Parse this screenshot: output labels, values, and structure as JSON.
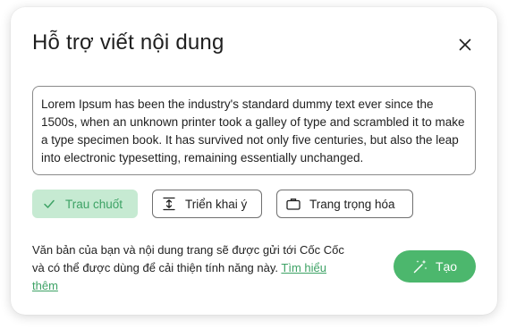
{
  "dialog": {
    "title": "Hỗ trợ viết nội dung",
    "close_icon": "close-icon"
  },
  "editor": {
    "text": "Lorem Ipsum has been the industry's standard dummy text ever since the 1500s, when an unknown printer took a galley of type and scrambled it to make a type specimen book. It has survived not only five centuries, but also the leap into electronic typesetting, remaining essentially unchanged."
  },
  "chips": [
    {
      "label": "Trau chuốt",
      "icon": "check-icon",
      "active": true
    },
    {
      "label": "Triển khai ý",
      "icon": "expand-vertical-icon",
      "active": false
    },
    {
      "label": "Trang trọng hóa",
      "icon": "briefcase-icon",
      "active": false
    }
  ],
  "footer": {
    "notice": "Văn bản của bạn và nội dung trang sẽ được gửi tới Cốc Cốc và có thể được dùng để cải thiện tính năng này.",
    "link": "Tìm hiểu thêm"
  },
  "create_button": {
    "label": "Tạo",
    "icon": "magic-wand-icon"
  },
  "colors": {
    "accent": "#4cb76d",
    "accent_light": "#c6ead2",
    "accent_text": "#3da265"
  }
}
